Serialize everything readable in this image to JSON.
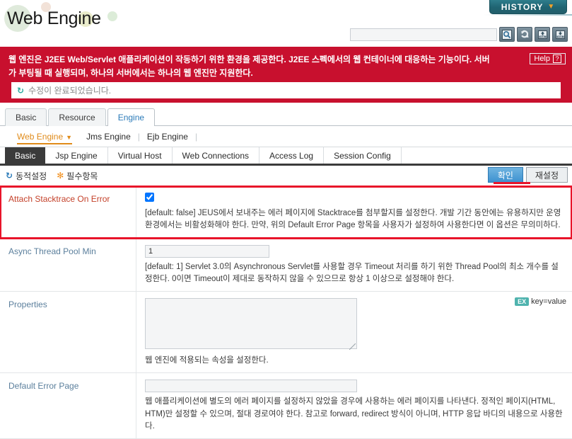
{
  "header": {
    "title": "Web Engine",
    "history_label": "HISTORY",
    "history_caret": "▼",
    "search_value": "",
    "search_placeholder": "",
    "icon_buttons": [
      {
        "name": "search-icon",
        "title": "Search"
      },
      {
        "name": "refresh-icon",
        "title": "Refresh"
      },
      {
        "name": "xml-import-icon",
        "title": "XML Up"
      },
      {
        "name": "xml-export-icon",
        "title": "XML Down"
      }
    ]
  },
  "banner": {
    "description": "웹 엔진은 J2EE Web/Servlet 애플리케이션이 작동하기 위한 환경을 제공한다. J2EE 스펙에서의 웹 컨테이너에 대응하는 기능이다. 서버가 부팅될 때 실행되며, 하나의 서버에서는 하나의 웹 엔진만 지원한다.",
    "help_label": "Help",
    "help_mark": "?",
    "status_message": "수정이 완료되었습니다.",
    "status_icon": "↻",
    "accent_color": "#c8102e",
    "highlight_color": "#e8142a"
  },
  "tabs": [
    {
      "label": "Basic",
      "active": false
    },
    {
      "label": "Resource",
      "active": false
    },
    {
      "label": "Engine",
      "active": true
    }
  ],
  "subnav": [
    {
      "label": "Web Engine",
      "active": true,
      "caret": "▼"
    },
    {
      "label": "Jms Engine",
      "active": false,
      "caret": ""
    },
    {
      "label": "Ejb Engine",
      "active": false,
      "caret": ""
    }
  ],
  "engine_tabs": [
    {
      "label": "Basic",
      "active": true
    },
    {
      "label": "Jsp Engine",
      "active": false
    },
    {
      "label": "Virtual Host",
      "active": false
    },
    {
      "label": "Web Connections",
      "active": false
    },
    {
      "label": "Access Log",
      "active": false
    },
    {
      "label": "Session Config",
      "active": false
    }
  ],
  "legend": {
    "dynamic_label": "동적설정",
    "dynamic_icon": "↻",
    "required_label": "필수항목",
    "required_icon": "✻"
  },
  "actions": {
    "confirm_label": "확인",
    "reset_label": "재설정"
  },
  "form": {
    "rows": [
      {
        "label": "Attach Stacktrace On Error",
        "type": "checkbox",
        "checked": true,
        "value": "",
        "description": "[default: false]   JEUS에서 보내주는 에러 페이지에 Stacktrace를 첨부할지를 설정한다. 개발 기간 동안에는 유용하지만 운영 환경에서는 비활성화해야 한다. 만약, 위의 Default Error Page 항목을 사용자가 설정하여 사용한다면 이 옵션은 무의미하다.",
        "highlighted": true
      },
      {
        "label": "Async Thread Pool Min",
        "type": "text",
        "value": "1",
        "description": "[default: 1]   Servlet 3.0의 Asynchronous Servlet를 사용할 경우 Timeout 처리를 하기 위한 Thread Pool의 최소 개수를 설정한다. 0이면 Timeout이 제대로 동작하지 않을 수 있으므로 항상 1 이상으로 설정해야 한다.",
        "highlighted": false
      },
      {
        "label": "Properties",
        "type": "textarea",
        "value": "",
        "hint_badge": "EX",
        "hint_text": "key=value",
        "description": "웹 엔진에 적용되는 속성을 설정한다.",
        "highlighted": false
      },
      {
        "label": "Default Error Page",
        "type": "text-wide",
        "value": "",
        "description": "웹 애플리케이션에 별도의 에러 페이지를 설정하지 않았을 경우에 사용하는 에러 페이지를 나타낸다. 정적인 페이지(HTML, HTM)만 설정할 수 있으며, 절대 경로여야 한다. 참고로 forward, redirect 방식이 아니며, HTTP 응답 바디의 내용으로 사용한다.",
        "highlighted": false
      }
    ]
  }
}
